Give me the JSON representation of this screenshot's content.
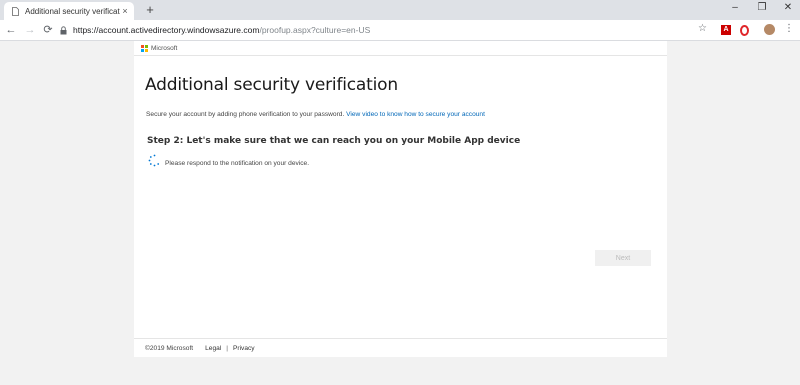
{
  "browser": {
    "tab_title": "Additional security verification",
    "tab_close": "×",
    "new_tab": "+",
    "url_host": "https://account.activedirectory.windowsazure.com",
    "url_path": "/proofup.aspx?culture=en-US",
    "window_minimize": "–",
    "window_restore": "❐",
    "window_close": "✕",
    "back": "←",
    "forward": "→",
    "reload": "⟳",
    "star": "☆",
    "menu": "⋮"
  },
  "header": {
    "brand": "Microsoft",
    "logo_colors": [
      "#f25022",
      "#7fba00",
      "#00a4ef",
      "#ffb900"
    ]
  },
  "main": {
    "title": "Additional security verification",
    "intro_text": "Secure your account by adding phone verification to your password.",
    "intro_link": "View video to know how to secure your account",
    "step_heading": "Step 2: Let's make sure that we can reach you on your Mobile App device",
    "respond_text": "Please respond to the notification on your device.",
    "next_label": "Next"
  },
  "footer": {
    "copyright": "©2019 Microsoft",
    "legal": "Legal",
    "separator": "|",
    "privacy": "Privacy"
  },
  "colors": {
    "link": "#0067b8",
    "spinner": "#0078d4"
  }
}
